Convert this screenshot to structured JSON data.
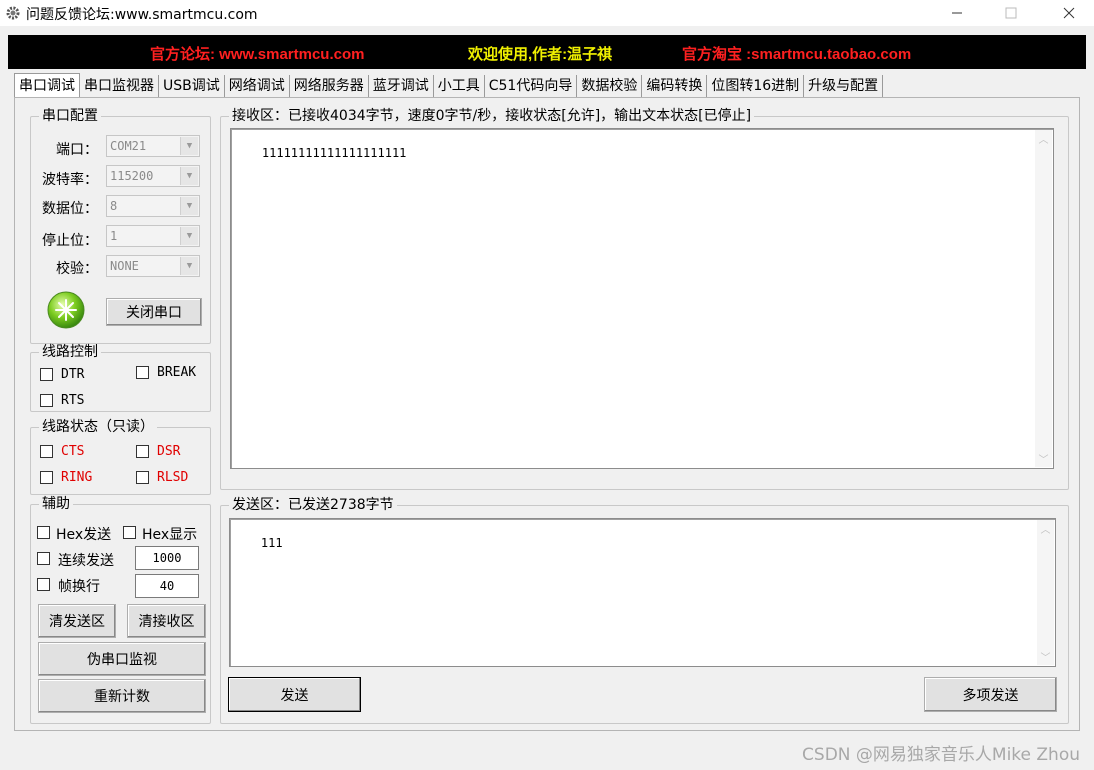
{
  "window": {
    "title": "问题反馈论坛:www.smartmcu.com",
    "min_icon": "minimize-icon",
    "max_icon": "maximize-icon",
    "close_icon": "close-icon"
  },
  "banner": {
    "left": "官方论坛: www.smartmcu.com",
    "middle": "欢迎使用,作者:温子祺",
    "right": "官方淘宝 :smartmcu.taobao.com",
    "colors": {
      "red": "#ff2020",
      "yellow": "#f0f000"
    }
  },
  "tabs": [
    "串口调试",
    "串口监视器",
    "USB调试",
    "网络调试",
    "网络服务器",
    "蓝牙调试",
    "小工具",
    "C51代码向导",
    "数据校验",
    "编码转换",
    "位图转16进制",
    "升级与配置"
  ],
  "serial_config": {
    "title": "串口配置",
    "port_label": "端口：",
    "port_value": "COM21",
    "baud_label": "波特率：",
    "baud_value": "115200",
    "databits_label": "数据位：",
    "databits_value": "8",
    "stopbits_label": "停止位：",
    "stopbits_value": "1",
    "parity_label": "校验：",
    "parity_value": "NONE",
    "status_icon": "port-open-indicator-icon",
    "close_port_label": "关闭串口"
  },
  "line_control": {
    "title": "线路控制",
    "dtr": "DTR",
    "break": "BREAK",
    "rts": "RTS"
  },
  "line_status": {
    "title": "线路状态（只读）",
    "cts": "CTS",
    "dsr": "DSR",
    "ring": "RING",
    "rlsd": "RLSD"
  },
  "aux": {
    "title": "辅助",
    "hex_send": "Hex发送",
    "hex_show": "Hex显示",
    "continuous_send": "连续发送",
    "interval_value": "1000",
    "frame_break": "帧换行",
    "frame_value": "40",
    "clear_send": "清发送区",
    "clear_recv": "清接收区",
    "pseudo_monitor": "伪串口监视",
    "recount": "重新计数"
  },
  "receive": {
    "title": "接收区：已接收4034字节，速度0字节/秒，接收状态[允许]，输出文本状态[已停止]",
    "content": "11111111111111111111"
  },
  "send": {
    "title": "发送区：已发送2738字节",
    "content": "111",
    "send_label": "发送",
    "multi_send_label": "多项发送"
  },
  "watermark": "CSDN @网易独家音乐人Mike Zhou"
}
